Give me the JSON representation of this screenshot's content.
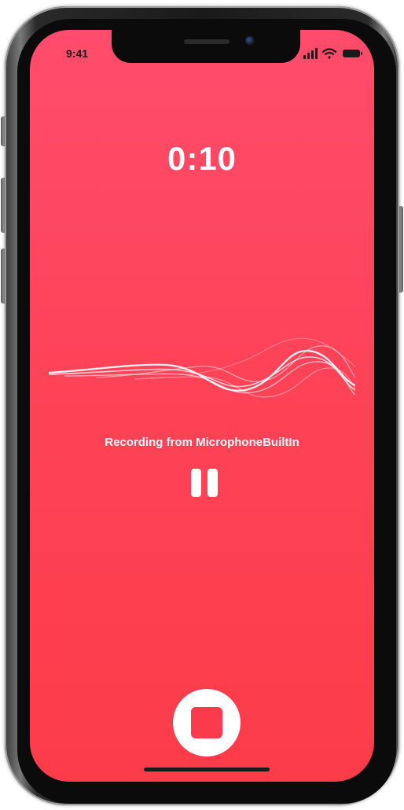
{
  "status_bar": {
    "time": "9:41",
    "icons": [
      "signal-icon",
      "wifi-icon",
      "battery-icon"
    ]
  },
  "recorder": {
    "elapsed_time": "0:10",
    "source_label": "Recording from MicrophoneBuiltIn"
  },
  "controls": {
    "pause": "pause-icon",
    "stop": "stop-icon"
  },
  "colors": {
    "background_top": "#ff4c6c",
    "background_bottom": "#fc3c49",
    "foreground": "#ffffff",
    "device_frame": "#1a1a1a"
  }
}
